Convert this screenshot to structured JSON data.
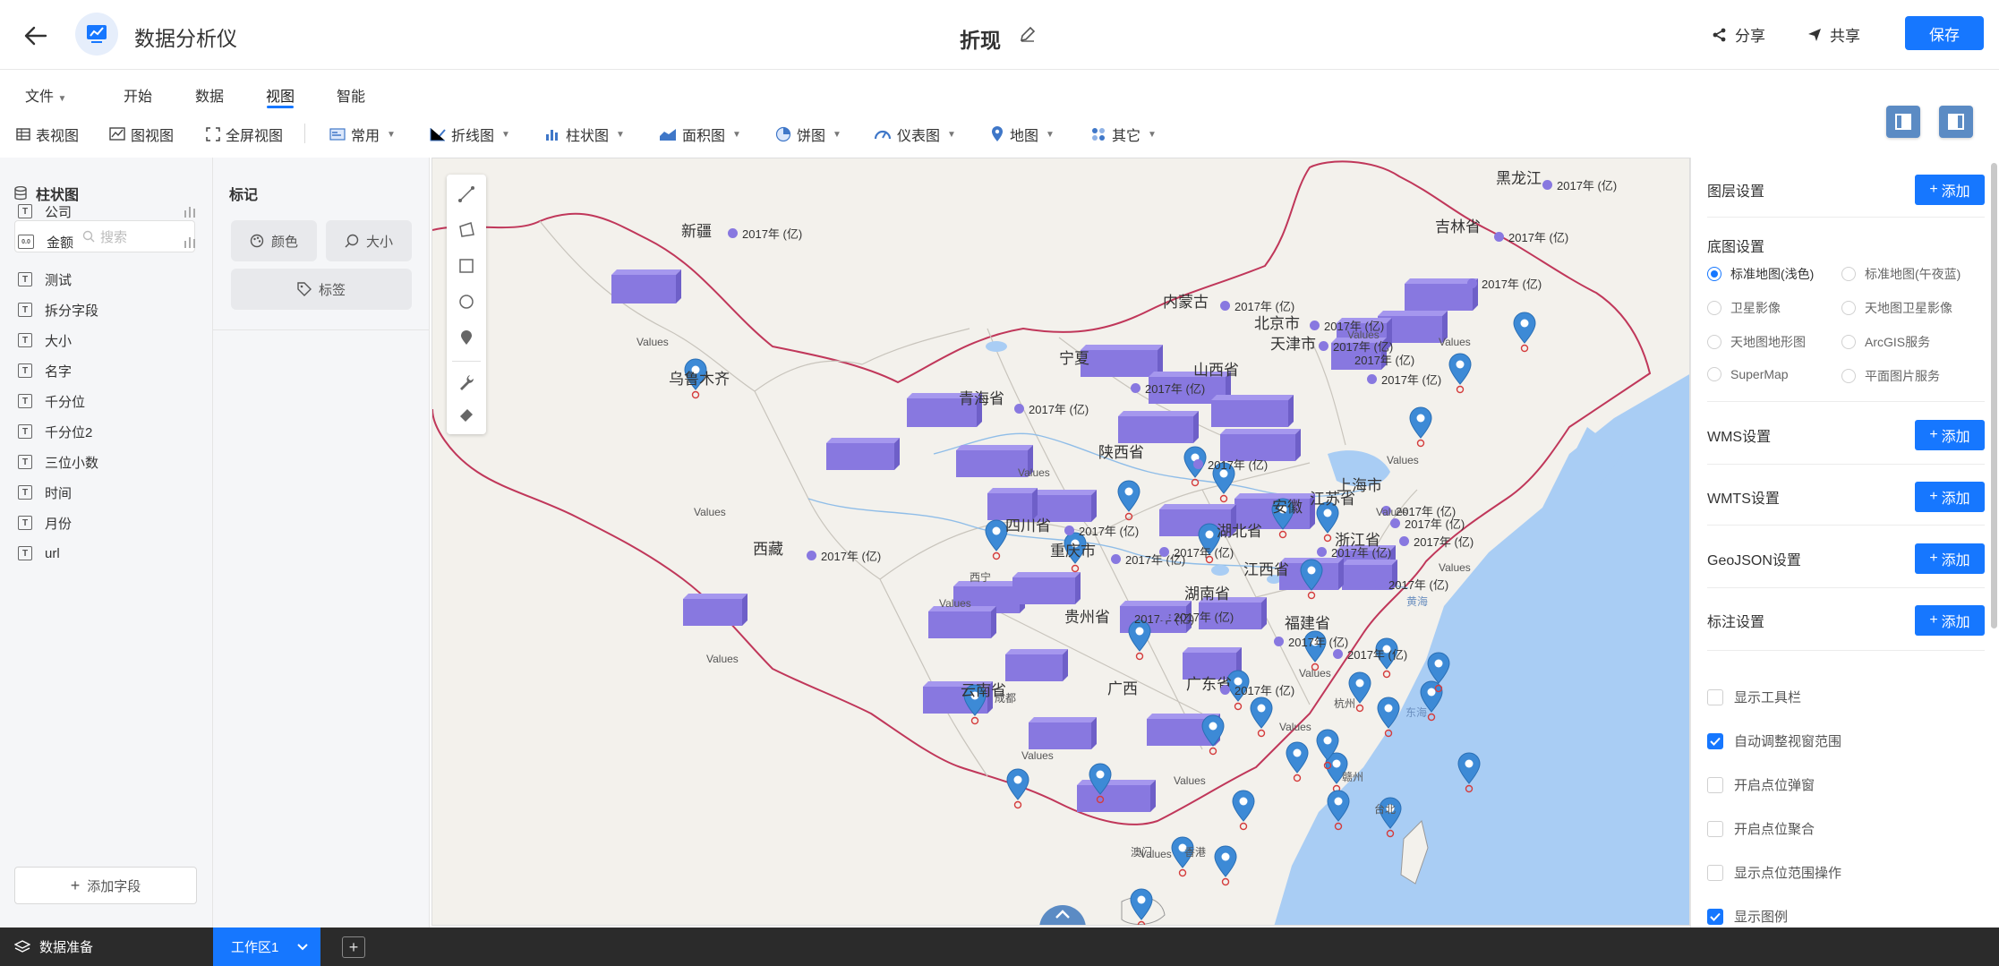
{
  "header": {
    "app_name": "数据分析仪",
    "doc_title": "折现",
    "share_label": "分享",
    "cooperate_label": "共享",
    "save_label": "保存"
  },
  "menu": {
    "items": [
      "文件",
      "开始",
      "数据",
      "视图",
      "智能"
    ],
    "active": "视图"
  },
  "toolbar": {
    "table_view": "表视图",
    "chart_view": "图视图",
    "fullscreen_view": "全屏视图",
    "common": "常用",
    "line": "折线图",
    "bar": "柱状图",
    "area": "面积图",
    "pie": "饼图",
    "gauge": "仪表图",
    "map": "地图",
    "other": "其它"
  },
  "left_panel": {
    "title": "柱状图",
    "search_placeholder": "搜索",
    "fields": [
      {
        "label": "公司",
        "type": "T",
        "chart": true
      },
      {
        "label": "金额",
        "type": "0.0",
        "chart": true
      },
      {
        "label": "测试",
        "type": "T"
      },
      {
        "label": "拆分字段",
        "type": "T"
      },
      {
        "label": "大小",
        "type": "T"
      },
      {
        "label": "名字",
        "type": "T"
      },
      {
        "label": "千分位",
        "type": "T"
      },
      {
        "label": "千分位2",
        "type": "T"
      },
      {
        "label": "三位小数",
        "type": "T"
      },
      {
        "label": "时间",
        "type": "T"
      },
      {
        "label": "月份",
        "type": "T"
      },
      {
        "label": "url",
        "type": "T"
      }
    ],
    "add_field": "添加字段"
  },
  "mark_panel": {
    "title": "标记",
    "color": "颜色",
    "size": "大小",
    "label": "标签"
  },
  "map": {
    "labels": [
      {
        "text": "新疆"
      },
      {
        "text": "乌鲁木齐"
      },
      {
        "text": "西藏"
      },
      {
        "text": "青海省"
      },
      {
        "text": "宁夏"
      },
      {
        "text": "内蒙古"
      },
      {
        "text": "北京市"
      },
      {
        "text": "天津市"
      },
      {
        "text": "山西省"
      },
      {
        "text": "陕西省"
      },
      {
        "text": "四川省"
      },
      {
        "text": "重庆市"
      },
      {
        "text": "贵州省"
      },
      {
        "text": "云南省"
      },
      {
        "text": "广西"
      },
      {
        "text": "广东省"
      },
      {
        "text": "湖南省"
      },
      {
        "text": "湖北省"
      },
      {
        "text": "江西省"
      },
      {
        "text": "安徽"
      },
      {
        "text": "江苏省"
      },
      {
        "text": "上海市"
      },
      {
        "text": "浙江省"
      },
      {
        "text": "福建省"
      },
      {
        "text": "黑龙江"
      },
      {
        "text": "吉林省"
      },
      {
        "text": "西宁"
      },
      {
        "text": "成都"
      },
      {
        "text": "杭州"
      },
      {
        "text": "赣州"
      },
      {
        "text": "澳门"
      },
      {
        "text": "香港"
      },
      {
        "text": "台北"
      },
      {
        "text": "东海"
      },
      {
        "text": "黄海"
      }
    ],
    "legend_label": "2017年 (亿)",
    "values_label": "Values"
  },
  "right_panel": {
    "layer_settings": "图层设置",
    "basemap_settings": "底图设置",
    "basemaps": [
      {
        "label": "标准地图(浅色)",
        "selected": true
      },
      {
        "label": "标准地图(午夜蓝)",
        "selected": false
      },
      {
        "label": "卫星影像",
        "selected": false
      },
      {
        "label": "天地图卫星影像",
        "selected": false
      },
      {
        "label": "天地图地形图",
        "selected": false
      },
      {
        "label": "ArcGIS服务",
        "selected": false
      },
      {
        "label": "SuperMap",
        "selected": false
      },
      {
        "label": "平面图片服务",
        "selected": false
      }
    ],
    "wms": "WMS设置",
    "wmts": "WMTS设置",
    "geojson": "GeoJSON设置",
    "annotation": "标注设置",
    "add_label": "添加",
    "options": [
      {
        "label": "显示工具栏",
        "checked": false
      },
      {
        "label": "自动调整视窗范围",
        "checked": true
      },
      {
        "label": "开启点位弹窗",
        "checked": false
      },
      {
        "label": "开启点位聚合",
        "checked": false
      },
      {
        "label": "显示点位范围操作",
        "checked": false
      },
      {
        "label": "显示图例",
        "checked": true
      }
    ]
  },
  "bottom": {
    "data_prep": "数据准备",
    "workspace": "工作区1"
  },
  "colors": {
    "accent": "#1677ff",
    "bar": "#8878e0",
    "pin": "#3d8ad6"
  }
}
